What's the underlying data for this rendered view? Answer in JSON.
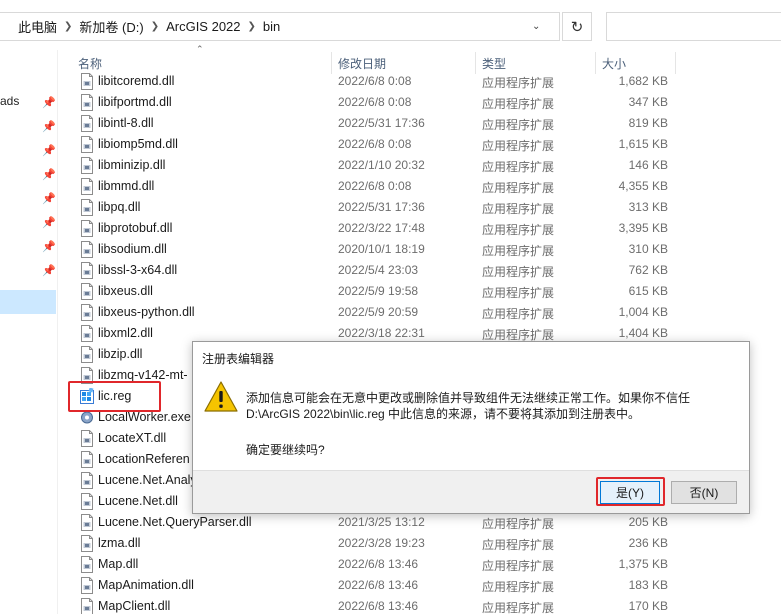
{
  "address_bar": {
    "breadcrumbs": [
      "此电脑",
      "新加卷 (D:)",
      "ArcGIS 2022",
      "bin"
    ],
    "refresh_icon": "refresh-icon"
  },
  "nav_pane": {
    "partial_label": "ads",
    "pin_icon": "pin-icon"
  },
  "columns": {
    "name": "名称",
    "date": "修改日期",
    "type": "类型",
    "size": "大小"
  },
  "files": [
    {
      "name": "libitcoremd.dll",
      "date": "2022/6/8 0:08",
      "type": "应用程序扩展",
      "size": "1,682 KB",
      "icon": "dll-icon"
    },
    {
      "name": "libifportmd.dll",
      "date": "2022/6/8 0:08",
      "type": "应用程序扩展",
      "size": "347 KB",
      "icon": "dll-icon"
    },
    {
      "name": "libintl-8.dll",
      "date": "2022/5/31 17:36",
      "type": "应用程序扩展",
      "size": "819 KB",
      "icon": "dll-icon"
    },
    {
      "name": "libiomp5md.dll",
      "date": "2022/6/8 0:08",
      "type": "应用程序扩展",
      "size": "1,615 KB",
      "icon": "dll-icon"
    },
    {
      "name": "libminizip.dll",
      "date": "2022/1/10 20:32",
      "type": "应用程序扩展",
      "size": "146 KB",
      "icon": "dll-icon"
    },
    {
      "name": "libmmd.dll",
      "date": "2022/6/8 0:08",
      "type": "应用程序扩展",
      "size": "4,355 KB",
      "icon": "dll-icon"
    },
    {
      "name": "libpq.dll",
      "date": "2022/5/31 17:36",
      "type": "应用程序扩展",
      "size": "313 KB",
      "icon": "dll-icon"
    },
    {
      "name": "libprotobuf.dll",
      "date": "2022/3/22 17:48",
      "type": "应用程序扩展",
      "size": "3,395 KB",
      "icon": "dll-icon"
    },
    {
      "name": "libsodium.dll",
      "date": "2020/10/1 18:19",
      "type": "应用程序扩展",
      "size": "310 KB",
      "icon": "dll-icon"
    },
    {
      "name": "libssl-3-x64.dll",
      "date": "2022/5/4 23:03",
      "type": "应用程序扩展",
      "size": "762 KB",
      "icon": "dll-icon"
    },
    {
      "name": "libxeus.dll",
      "date": "2022/5/9 19:58",
      "type": "应用程序扩展",
      "size": "615 KB",
      "icon": "dll-icon"
    },
    {
      "name": "libxeus-python.dll",
      "date": "2022/5/9 20:59",
      "type": "应用程序扩展",
      "size": "1,004 KB",
      "icon": "dll-icon"
    },
    {
      "name": "libxml2.dll",
      "date": "2022/3/18 22:31",
      "type": "应用程序扩展",
      "size": "1,404 KB",
      "icon": "dll-icon"
    },
    {
      "name": "libzip.dll",
      "date": "",
      "type": "",
      "size": "",
      "icon": "dll-icon"
    },
    {
      "name": "libzmq-v142-mt-",
      "date": "",
      "type": "",
      "size": "",
      "icon": "dll-icon"
    },
    {
      "name": "lic.reg",
      "date": "",
      "type": "",
      "size": "",
      "icon": "registry-file-icon"
    },
    {
      "name": "LocalWorker.exe",
      "date": "",
      "type": "",
      "size": "",
      "icon": "gear-exe-icon"
    },
    {
      "name": "LocateXT.dll",
      "date": "",
      "type": "",
      "size": "",
      "icon": "dll-icon"
    },
    {
      "name": "LocationReferen",
      "date": "",
      "type": "",
      "size": "",
      "icon": "dll-icon"
    },
    {
      "name": "Lucene.Net.Analy",
      "date": "",
      "type": "",
      "size": "",
      "icon": "dll-icon"
    },
    {
      "name": "Lucene.Net.dll",
      "date": "",
      "type": "",
      "size": "",
      "icon": "dll-icon"
    },
    {
      "name": "Lucene.Net.QueryParser.dll",
      "date": "2021/3/25 13:12",
      "type": "应用程序扩展",
      "size": "205 KB",
      "icon": "dll-icon"
    },
    {
      "name": "lzma.dll",
      "date": "2022/3/28 19:23",
      "type": "应用程序扩展",
      "size": "236 KB",
      "icon": "dll-icon"
    },
    {
      "name": "Map.dll",
      "date": "2022/6/8 13:46",
      "type": "应用程序扩展",
      "size": "1,375 KB",
      "icon": "dll-icon"
    },
    {
      "name": "MapAnimation.dll",
      "date": "2022/6/8 13:46",
      "type": "应用程序扩展",
      "size": "183 KB",
      "icon": "dll-icon"
    },
    {
      "name": "MapClient.dll",
      "date": "2022/6/8 13:46",
      "type": "应用程序扩展",
      "size": "170 KB",
      "icon": "dll-icon"
    }
  ],
  "dialog": {
    "title": "注册表编辑器",
    "icon": "warning-icon",
    "message_line1": "添加信息可能会在无意中更改或删除值并导致组件无法继续正常工作。如果你不信任",
    "message_line2": "D:\\ArcGIS 2022\\bin\\lic.reg 中此信息的来源，请不要将其添加到注册表中。",
    "confirm": "确定要继续吗?",
    "yes_label": "是(Y)",
    "no_label": "否(N)"
  },
  "colors": {
    "highlight_red": "#e0272b",
    "selection_blue": "#cce8ff",
    "default_button_border": "#0078d7",
    "warning_yellow": "#f5c400"
  }
}
